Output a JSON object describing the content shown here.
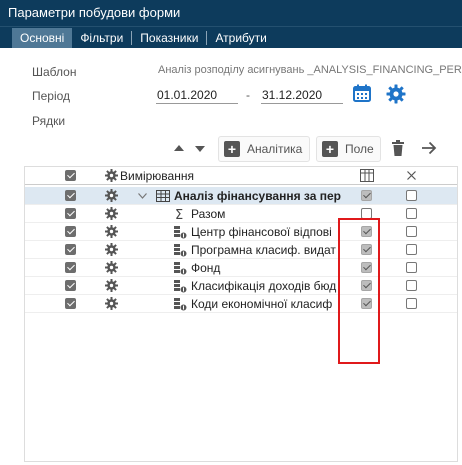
{
  "window": {
    "title": "Параметри побудови форми"
  },
  "tabs": [
    {
      "label": "Основні",
      "active": true
    },
    {
      "label": "Фільтри",
      "active": false
    },
    {
      "label": "Показники",
      "active": false
    },
    {
      "label": "Атрибути",
      "active": false
    }
  ],
  "form": {
    "template_label": "Шаблон",
    "template_value": "Аналіз розподілу асигнувань _ANALYSIS_FINANCING_PERIOD",
    "period_label": "Період",
    "period_from": "01.01.2020",
    "period_dash": "-",
    "period_to": "31.12.2020",
    "rows_label": "Рядки"
  },
  "toolbar": {
    "analytics_label": "Аналітика",
    "field_label": "Поле"
  },
  "grid": {
    "header": {
      "dimension_label": "Вимірювання"
    },
    "rows": [
      {
        "label": "Аналіз фінансування за пер",
        "bold": true,
        "icon": "table-icon",
        "check_a": true,
        "check_b": false
      },
      {
        "label": "Разом",
        "bold": false,
        "icon": "sigma-icon",
        "check_a": false,
        "check_b": false
      },
      {
        "label": "Центр фінансової відпові",
        "bold": false,
        "icon": "dimension-icon",
        "check_a": true,
        "check_b": false
      },
      {
        "label": "Програмна класиф. видат",
        "bold": false,
        "icon": "dimension-icon",
        "check_a": true,
        "check_b": false
      },
      {
        "label": "Фонд",
        "bold": false,
        "icon": "dimension-icon",
        "check_a": true,
        "check_b": false
      },
      {
        "label": "Класифікація доходів бюд",
        "bold": false,
        "icon": "dimension-icon",
        "check_a": true,
        "check_b": false
      },
      {
        "label": "Коди економічної класиф",
        "bold": false,
        "icon": "dimension-icon",
        "check_a": true,
        "check_b": false
      }
    ]
  },
  "colors": {
    "title_bg": "#0d3b5c",
    "active_tab_bg": "#4f7896",
    "accent_blue": "#1f74c8",
    "highlight_outline": "#e0191b",
    "selected_row_bg": "#dde8f2"
  }
}
